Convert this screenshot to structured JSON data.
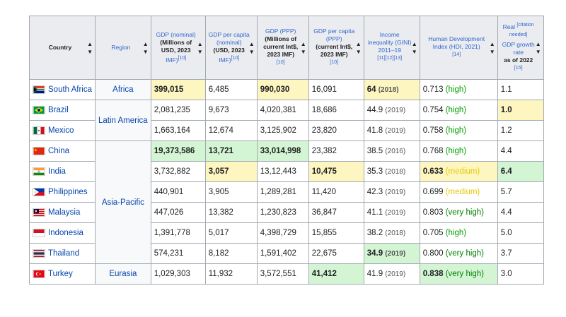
{
  "headers": {
    "country": {
      "text": "Country",
      "icon": "sort-icon"
    },
    "region": {
      "text": "Region",
      "icon": "sort-icon"
    },
    "gdp": {
      "line1": "GDP (nominal)",
      "line2": "(Millions of USD, 2023",
      "line3": "IMF)",
      "ref": "[10]"
    },
    "gdp_pc": {
      "line1": "GDP per capita (nominal)",
      "line2": "(USD, 2023",
      "line3": "IMF)",
      "ref": "[10]"
    },
    "gdp_ppp": {
      "line1": "GDP (PPP)",
      "line2": "(Millions of current Int$, 2023 IMF)",
      "ref": "[10]"
    },
    "gdp_ppp_pc": {
      "line1": "GDP per capita (PPP)",
      "line2": "(current Int$, 2023 IMF)",
      "ref": "[10]"
    },
    "inequality": {
      "line1": "Income inequality (GINI) 2011–19",
      "ref": "[11][12][13]"
    },
    "hdi": {
      "line1": "Human Development Index (HDI, 2021)",
      "ref": "[14]"
    },
    "growth": {
      "line1": "Real",
      "edit": "[citation needed]",
      "line2": "GDP growth rate",
      "line3": "as of 2022",
      "ref": "[15]"
    }
  },
  "rows": [
    {
      "country": "South Africa",
      "region": "Africa",
      "gdp": "399,015",
      "pc": "6,485",
      "ppp": "990,030",
      "ppppc": "16,091",
      "gini": "64",
      "gini_yr": "(2018)",
      "hdi": "0.713",
      "hdi_lvl": "(high)",
      "growth": "1.1"
    },
    {
      "country": "Brazil",
      "region": "Latin America",
      "gdp": "2,081,235",
      "pc": "9,673",
      "ppp": "4,020,381",
      "ppppc": "18,686",
      "gini": "44.9",
      "gini_yr": "(2019)",
      "hdi": "0.754",
      "hdi_lvl": "(high)",
      "growth": "1.0"
    },
    {
      "country": "Mexico",
      "gdp": "1,663,164",
      "pc": "12,674",
      "ppp": "3,125,902",
      "ppppc": "23,820",
      "gini": "41.8",
      "gini_yr": "(2019)",
      "hdi": "0.758",
      "hdi_lvl": "(high)",
      "growth": "1.2"
    },
    {
      "country": "China",
      "region": "Asia-Pacific",
      "gdp": "19,373,586",
      "pc": "13,721",
      "ppp": "33,014,998",
      "ppppc": "23,382",
      "gini": "38.5",
      "gini_yr": "(2016)",
      "hdi": "0.768",
      "hdi_lvl": "(high)",
      "growth": "4.4"
    },
    {
      "country": "India",
      "gdp": "3,732,882",
      "pc": "3,057",
      "ppp": "13,12,443",
      "ppppc": "10,475",
      "gini": "35.3",
      "gini_yr": "(2018)",
      "hdi": "0.633",
      "hdi_lvl": "(medium)",
      "growth": "6.4"
    },
    {
      "country": "Philippines",
      "gdp": "440,901",
      "pc": "3,905",
      "ppp": "1,289,281",
      "ppppc": "11,420",
      "gini": "42.3",
      "gini_yr": "(2019)",
      "hdi": "0.699",
      "hdi_lvl": "(medium)",
      "growth": "5.7"
    },
    {
      "country": "Malaysia",
      "gdp": "447,026",
      "pc": "13,382",
      "ppp": "1,230,823",
      "ppppc": "36,847",
      "gini": "41.1",
      "gini_yr": "(2019)",
      "hdi": "0.803",
      "hdi_lvl": "(very high)",
      "growth": "4.4"
    },
    {
      "country": "Indonesia",
      "gdp": "1,391,778",
      "pc": "5,017",
      "ppp": "4,398,729",
      "ppppc": "15,855",
      "gini": "38.2",
      "gini_yr": "(2018)",
      "hdi": "0.705",
      "hdi_lvl": "(high)",
      "growth": "5.0"
    },
    {
      "country": "Thailand",
      "gdp": "574,231",
      "pc": "8,182",
      "ppp": "1,591,402",
      "ppppc": "22,675",
      "gini": "34.9",
      "gini_yr": "(2019)",
      "hdi": "0.800",
      "hdi_lvl": "(very high)",
      "growth": "3.7"
    },
    {
      "country": "Turkey",
      "region": "Eurasia",
      "gdp": "1,029,303",
      "pc": "11,932",
      "ppp": "3,572,551",
      "ppppc": "41,412",
      "gini": "41.9",
      "gini_yr": "(2019)",
      "hdi": "0.838",
      "hdi_lvl": "(very high)",
      "growth": "3.0"
    }
  ],
  "colors": {
    "highlight_yellow": "#fef6c1",
    "highlight_green": "#d4f5d4",
    "link": "#0645ad",
    "header_bg": "#eaecf0"
  }
}
